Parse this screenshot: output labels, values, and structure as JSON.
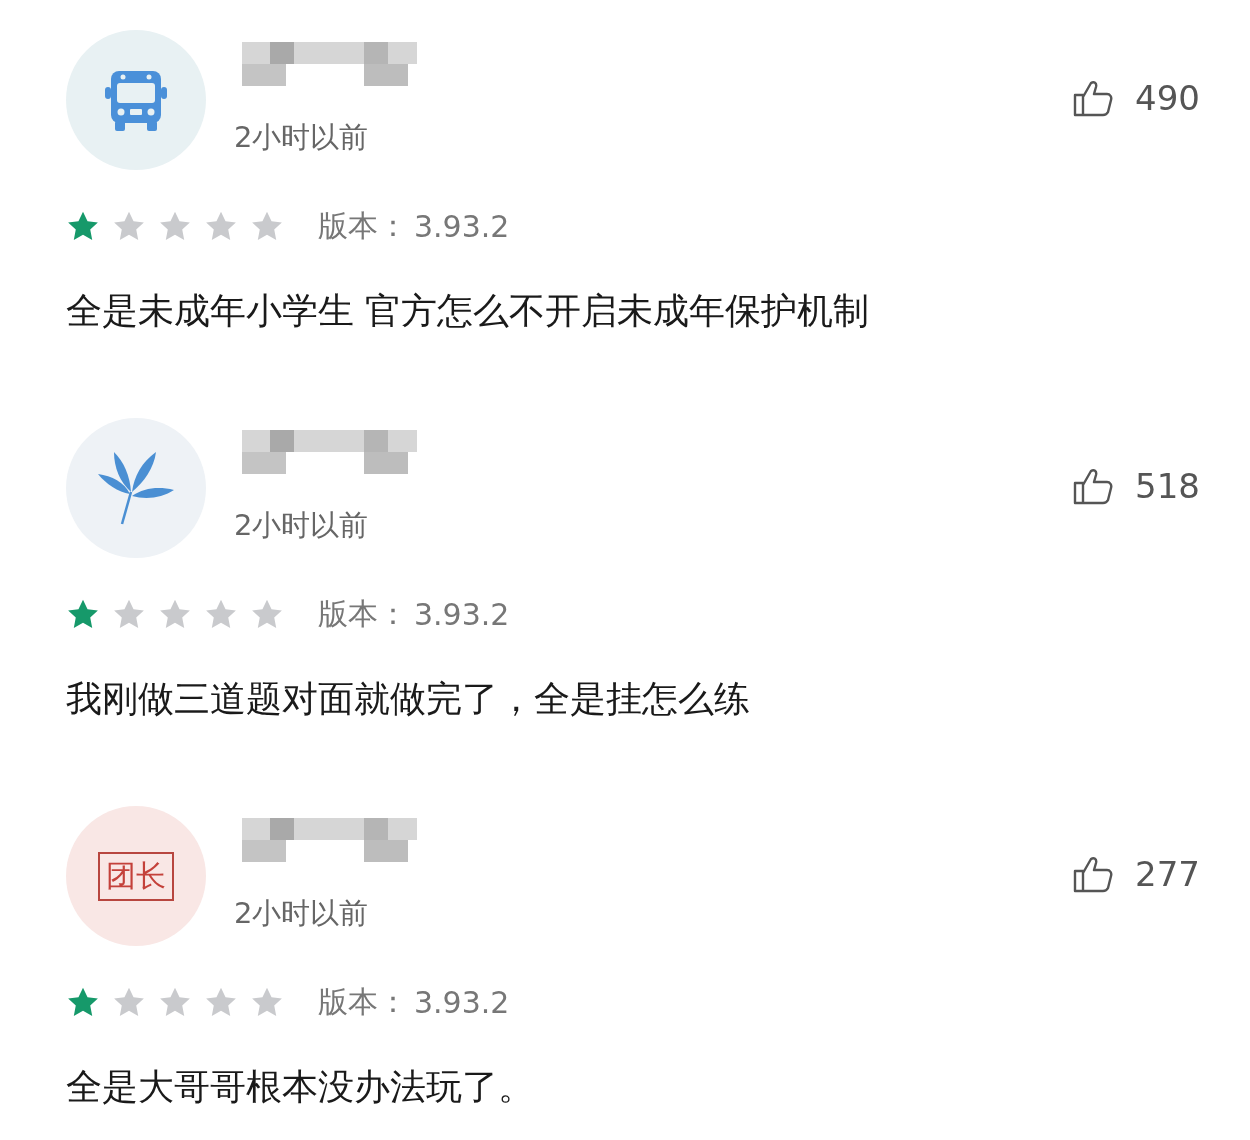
{
  "reviews": [
    {
      "avatar": {
        "kind": "bus"
      },
      "time": "2小时以前",
      "stars": 1,
      "version_label": "版本：",
      "version": "3.93.2",
      "text": "全是未成年小学生 官方怎么不开启未成年保护机制",
      "likes": "490"
    },
    {
      "avatar": {
        "kind": "leaf"
      },
      "time": "2小时以前",
      "stars": 1,
      "version_label": "版本：",
      "version": "3.93.2",
      "text": "我刚做三道题对面就做完了，全是挂怎么练",
      "likes": "518"
    },
    {
      "avatar": {
        "kind": "badge",
        "text": "团长"
      },
      "time": "2小时以前",
      "stars": 1,
      "version_label": "版本：",
      "version": "3.93.2",
      "text": "全是大哥哥根本没办法玩了。",
      "likes": "277"
    }
  ]
}
